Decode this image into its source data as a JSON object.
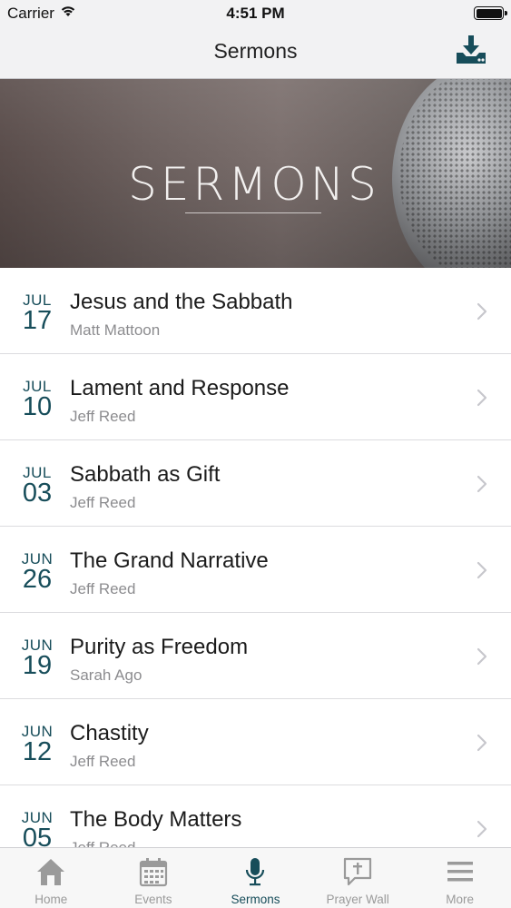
{
  "status_bar": {
    "carrier": "Carrier",
    "time": "4:51 PM"
  },
  "nav": {
    "title": "Sermons",
    "download_icon": "download-icon"
  },
  "hero": {
    "title": "SERMONS"
  },
  "sermons": [
    {
      "month": "JUL",
      "day": "17",
      "title": "Jesus and the Sabbath",
      "speaker": "Matt Mattoon"
    },
    {
      "month": "JUL",
      "day": "10",
      "title": "Lament and Response",
      "speaker": "Jeff Reed"
    },
    {
      "month": "JUL",
      "day": "03",
      "title": "Sabbath as Gift",
      "speaker": "Jeff Reed"
    },
    {
      "month": "JUN",
      "day": "26",
      "title": "The Grand Narrative",
      "speaker": "Jeff Reed"
    },
    {
      "month": "JUN",
      "day": "19",
      "title": "Purity as Freedom",
      "speaker": "Sarah Ago"
    },
    {
      "month": "JUN",
      "day": "12",
      "title": "Chastity",
      "speaker": "Jeff Reed"
    },
    {
      "month": "JUN",
      "day": "05",
      "title": "The Body Matters",
      "speaker": "Jeff Reed"
    }
  ],
  "tabs": [
    {
      "label": "Home",
      "icon": "home-icon",
      "active": false
    },
    {
      "label": "Events",
      "icon": "calendar-icon",
      "active": false
    },
    {
      "label": "Sermons",
      "icon": "microphone-icon",
      "active": true
    },
    {
      "label": "Prayer Wall",
      "icon": "prayer-bubble-icon",
      "active": false
    },
    {
      "label": "More",
      "icon": "menu-icon",
      "active": false
    }
  ],
  "colors": {
    "accent": "#174d5a",
    "inactive": "#9a9a9a"
  }
}
